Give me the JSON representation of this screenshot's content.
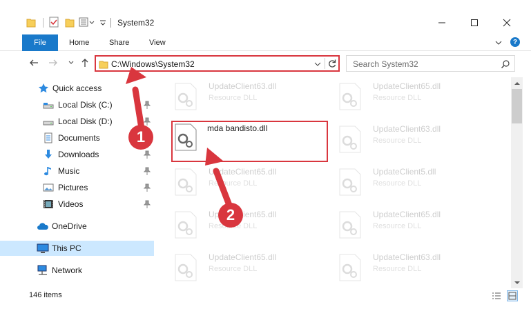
{
  "window": {
    "title": "System32",
    "minimize_icon": "minimize-icon",
    "maximize_icon": "maximize-icon",
    "close_icon": "close-icon"
  },
  "ribbon": {
    "tabs": [
      "File",
      "Home",
      "Share",
      "View"
    ],
    "help_label": "?"
  },
  "address": {
    "path": "C:\\Windows\\System32"
  },
  "search": {
    "placeholder": "Search System32"
  },
  "sidebar": {
    "items": [
      {
        "label": "Quick access",
        "icon": "star-icon"
      },
      {
        "label": "Local Disk (C:)",
        "icon": "drive-icon",
        "pinned": true
      },
      {
        "label": "Local Disk (D:)",
        "icon": "drive-icon",
        "pinned": true
      },
      {
        "label": "Documents",
        "icon": "documents-icon",
        "pinned": true
      },
      {
        "label": "Downloads",
        "icon": "download-icon",
        "pinned": true
      },
      {
        "label": "Music",
        "icon": "music-icon",
        "pinned": true
      },
      {
        "label": "Pictures",
        "icon": "pictures-icon",
        "pinned": true
      },
      {
        "label": "Videos",
        "icon": "videos-icon",
        "pinned": true
      },
      {
        "label": "OneDrive",
        "icon": "cloud-icon"
      },
      {
        "label": "This PC",
        "icon": "computer-icon",
        "selected": true
      },
      {
        "label": "Network",
        "icon": "network-icon"
      }
    ]
  },
  "files": [
    {
      "name": "UpdateClient63.dll",
      "type": "Resource DLL"
    },
    {
      "name": "UpdateClient65.dll",
      "type": "Resource DLL"
    },
    {
      "name": "mda bandisto.dll",
      "type": ""
    },
    {
      "name": "UpdateClient63.dll",
      "type": "Resource DLL"
    },
    {
      "name": "UpdateClient65.dll",
      "type": "Resource DLL"
    },
    {
      "name": "UpdateClient5.dll",
      "type": "Resource DLL"
    },
    {
      "name": "UpdateClient65.dll",
      "type": "Resource DLL"
    },
    {
      "name": "UpdateClient65.dll",
      "type": "Resource DLL"
    },
    {
      "name": "UpdateClient65.dll",
      "type": "Resource DLL"
    },
    {
      "name": "UpdateClient63.dll",
      "type": "Resource DLL"
    }
  ],
  "status": {
    "items_count": "146 items"
  },
  "annotations": {
    "step1": "1",
    "step2": "2",
    "color": "#d9363e"
  }
}
